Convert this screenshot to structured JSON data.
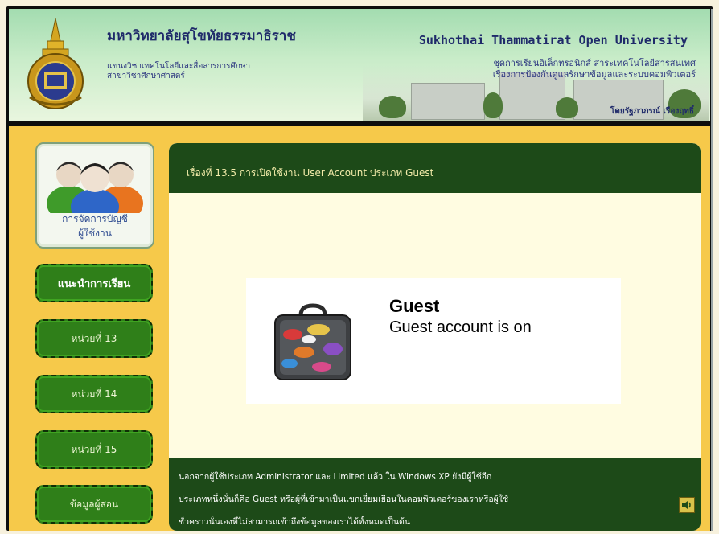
{
  "header": {
    "thai_title": "มหาวิทยาลัยสุโขทัยธรรมาธิราช",
    "thai_sub1": "แขนงวิชาเทคโนโลยีและสื่อสารการศึกษา",
    "thai_sub2": "สาขาวิชาศึกษาศาสตร์",
    "english_title": "Sukhothai Thammatirat Open University",
    "right_sub1": "ชุดการเรียนอิเล็กทรอนิกส์ สาระเทคโนโลยีสารสนเทศ",
    "right_sub2": "เรื่องการป้องกันดูแลรักษาข้อมูลและระบบคอมพิวเตอร์",
    "author": "โดยรัฐภาภรณ์ เรืองฤทธิ์"
  },
  "sidebar": {
    "card_label_line1": "การจัดการบัญชี",
    "card_label_line2": "ผู้ใช้งาน",
    "buttons": [
      {
        "label": "แนะนำการเรียน"
      },
      {
        "label": "หน่วยที่ 13"
      },
      {
        "label": "หน่วยที่ 14"
      },
      {
        "label": "หน่วยที่ 15"
      },
      {
        "label": "ข้อมูลผู้สอน"
      }
    ]
  },
  "content": {
    "title": "เรื่องที่ 13.5 การเปิดใช้งาน User Account ประเภท Guest",
    "figure": {
      "account_name": "Guest",
      "account_status": "Guest account is on"
    },
    "footer_lines": [
      "นอกจากผู้ใช้ประเภท Administrator และ Limited แล้ว ใน Windows XP ยังมีผู้ใช้อีก",
      "ประเภทหนึ่งนั่นก็คือ Guest หรือผู้ที่เข้ามาเป็นแขกเยี่ยมเยือนในคอมพิวเตอร์ของเราหรือผู้ใช้",
      "ชั่วคราวนั่นเองที่ไม่สามารถเข้าถึงข้อมูลของเราได้ทั้งหมดเป็นต้น"
    ]
  },
  "colors": {
    "accent_green": "#1d4a18",
    "sidebar_yellow": "#f6c94a",
    "button_green": "#2f7f19"
  }
}
